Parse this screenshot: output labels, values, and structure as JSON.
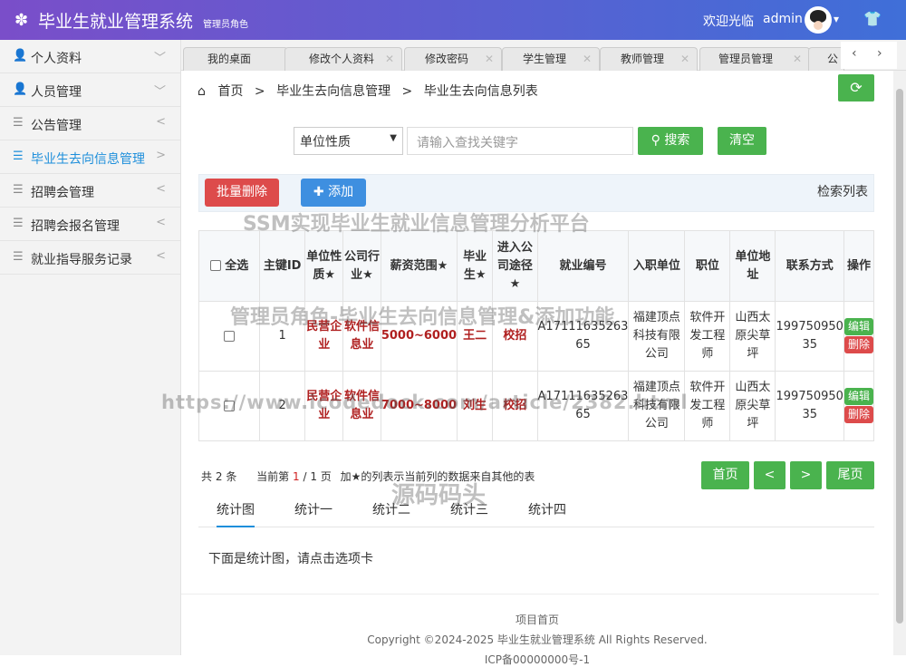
{
  "header": {
    "title": "毕业生就业管理系统",
    "role": "管理员角色",
    "welcome": "欢迎光临",
    "username": "admin"
  },
  "sidebar": {
    "items": [
      {
        "label": "个人资料",
        "icon": "user-icon"
      },
      {
        "label": "人员管理",
        "icon": "user-icon"
      },
      {
        "label": "公告管理",
        "icon": "list-icon"
      },
      {
        "label": "毕业生去向信息管理",
        "icon": "list-icon",
        "active": true
      },
      {
        "label": "招聘会管理",
        "icon": "list-icon"
      },
      {
        "label": "招聘会报名管理",
        "icon": "list-icon"
      },
      {
        "label": "就业指导服务记录",
        "icon": "list-icon"
      }
    ]
  },
  "tabs": [
    "我的桌面",
    "修改个人资料",
    "修改密码",
    "学生管理",
    "教师管理",
    "管理员管理",
    "公"
  ],
  "breadcrumb": {
    "home": "首页",
    "level1": "毕业生去向信息管理",
    "level2": "毕业生去向信息列表"
  },
  "search": {
    "select_value": "单位性质",
    "placeholder": "请输入查找关键字",
    "search_label": "搜索",
    "clear_label": "清空"
  },
  "toolbar": {
    "batch_delete": "批量删除",
    "add": "添加",
    "search_list": "检索列表"
  },
  "watermarks": {
    "line1": "SSM实现毕业生就业信息管理分析平台",
    "line2": "管理员角色-毕业生去向信息管理&添加功能",
    "line3": "https://www.icodedock.com/article/2382.html",
    "line4": "源码码头"
  },
  "table": {
    "headers": {
      "select_all": "全选",
      "id": "主键ID",
      "unit_nature": "单位性质★",
      "industry": "公司行业★",
      "salary": "薪资范围★",
      "graduate": "毕业生★",
      "path": "进入公司途径★",
      "job_no": "就业编号",
      "company": "入职单位",
      "position": "职位",
      "address": "单位地址",
      "contact": "联系方式",
      "ops": "操作"
    },
    "rows": [
      {
        "id": "1",
        "unit_nature": "民营企业",
        "industry": "软件信息业",
        "salary": "5000~6000",
        "graduate": "王二",
        "path": "校招",
        "job_no": "A17111635263 65",
        "company": "福建顶点科技有限公司",
        "position": "软件开发工程师",
        "address": "山西太原尖草坪",
        "contact": "199750950 35",
        "edit": "编辑",
        "delete": "删除"
      },
      {
        "id": "2",
        "unit_nature": "民营企业",
        "industry": "软件信息业",
        "salary": "7000~8000",
        "graduate": "刘生",
        "path": "校招",
        "job_no": "A17111635263 65",
        "company": "福建顶点科技有限公司",
        "position": "软件开发工程师",
        "address": "山西太原尖草坪",
        "contact": "199750950 35",
        "edit": "编辑",
        "delete": "删除"
      }
    ]
  },
  "pagination": {
    "total_prefix": "共",
    "total": "2",
    "total_suffix": "条",
    "current_prefix": "当前第",
    "current": "1",
    "pages_suffix": "/ 1 页",
    "note": "加★的列表示当前列的数据来自其他的表",
    "first": "首页",
    "prev": "<",
    "next": ">",
    "last": "尾页"
  },
  "stats_tabs": [
    "统计图",
    "统计一",
    "统计二",
    "统计三",
    "统计四"
  ],
  "stats_hint": "下面是统计图，请点击选项卡",
  "footer": {
    "home_link": "项目首页",
    "copyright": "Copyright ©2024-2025 毕业生就业管理系统 All Rights Reserved.",
    "icp": "ICP备00000000号-1"
  },
  "colors": {
    "accent": "#1e8fdb",
    "success": "#4ab34e",
    "danger": "#dd4b4b",
    "primary": "#3e8fe0",
    "header_start": "#7a4ec9",
    "header_end": "#3f6fd8"
  }
}
